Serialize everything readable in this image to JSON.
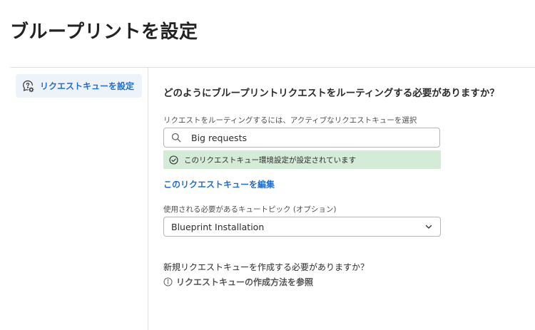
{
  "page": {
    "title": "ブループリントを設定"
  },
  "sidebar": {
    "items": [
      {
        "label": "リクエストキューを設定",
        "icon": "queue-settings-icon"
      }
    ]
  },
  "main": {
    "question": "どのようにブループリントリクエストをルーティングする必要がありますか？",
    "queue_field": {
      "label": "リクエストをルーティングするには、アクティブなリクエストキューを選択",
      "value": "Big requests",
      "icon": "search-icon"
    },
    "status": {
      "text": "このリクエストキュー環境設定が設定されています",
      "icon": "check-circle-icon",
      "color": "#d3ebd7"
    },
    "edit_link": "このリクエストキューを編集",
    "topic_field": {
      "label": "使用される必要があるキュートピック (オプション)",
      "selected": "Blueprint Installation",
      "icon": "chevron-down-icon"
    },
    "new_queue_question": "新規リクエストキューを作成する必要がありますか？",
    "help_link": {
      "text": "リクエストキューの作成方法を参照",
      "icon": "info-icon"
    }
  },
  "colors": {
    "accent": "#1f6fd1",
    "sidebar_active_bg": "#eef3fa",
    "success_bg": "#d3ebd7"
  }
}
